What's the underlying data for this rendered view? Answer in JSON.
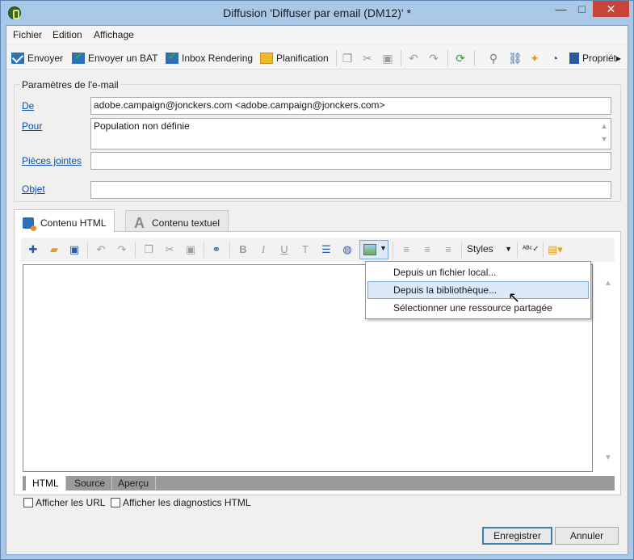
{
  "window": {
    "title": "Diffusion 'Diffuser par email (DM12)' *",
    "min_label": "—",
    "max_label": "□",
    "close_label": "✕"
  },
  "menu": [
    "Fichier",
    "Edition",
    "Affichage"
  ],
  "toolbar": {
    "send": "Envoyer",
    "send_bat": "Envoyer un BAT",
    "inbox": "Inbox Rendering",
    "planning": "Planification",
    "props": "Propriét▸"
  },
  "params": {
    "legend": "Paramètres de l'e-mail",
    "from_label": "De",
    "from_value": "adobe.campaign@jonckers.com <adobe.campaign@jonckers.com>",
    "to_label": "Pour",
    "to_value": "Population non définie",
    "attach_label": "Pièces jointes",
    "attach_value": "",
    "subject_label": "Objet",
    "subject_value": ""
  },
  "tabs": {
    "html": "Contenu HTML",
    "text": "Contenu textuel"
  },
  "editor": {
    "styles": "Styles",
    "bold": "B",
    "italic": "I",
    "underline": "U",
    "clear_format": "T"
  },
  "dropdown": {
    "items": [
      "Depuis un fichier local...",
      "Depuis la bibliothèque...",
      "Sélectionner une ressource partagée"
    ]
  },
  "bottom_tabs": [
    "HTML",
    "Source",
    "Aperçu"
  ],
  "checks": {
    "urls": "Afficher les URL",
    "diag": "Afficher les diagnostics HTML"
  },
  "buttons": {
    "save": "Enregistrer",
    "cancel": "Annuler"
  }
}
